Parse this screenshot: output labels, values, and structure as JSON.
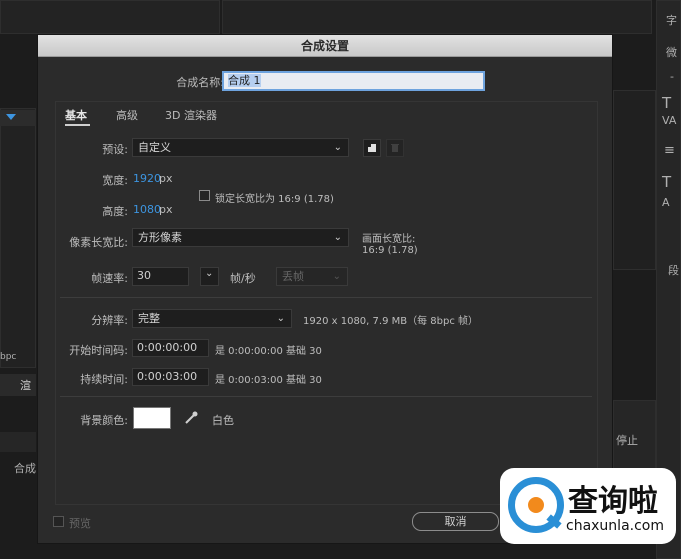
{
  "dialog": {
    "title": "合成设置",
    "name_label": "合成名称:",
    "name_value": "合成 1",
    "tabs": [
      {
        "label": "基本"
      },
      {
        "label": "高级"
      },
      {
        "label": "3D 渲染器"
      }
    ],
    "preset": {
      "label": "预设:",
      "value": "自定义"
    },
    "width": {
      "label": "宽度:",
      "value": "1920",
      "unit": "px"
    },
    "height": {
      "label": "高度:",
      "value": "1080",
      "unit": "px"
    },
    "lock_aspect": {
      "label": "锁定长宽比为 16:9 (1.78)",
      "checked": false
    },
    "pixel_aspect": {
      "label": "像素长宽比:",
      "value": "方形像素"
    },
    "frame_aspect": {
      "label": "画面长宽比:",
      "value": "16:9 (1.78)"
    },
    "frame_rate": {
      "label": "帧速率:",
      "value": "30",
      "unit": "帧/秒",
      "drop_frame": "丢帧"
    },
    "resolution": {
      "label": "分辨率:",
      "value": "完整",
      "info": "1920 x 1080, 7.9 MB（每 8bpc 帧）"
    },
    "start_timecode": {
      "label": "开始时间码:",
      "value": "0:00:00:00",
      "info": "是 0:00:00:00 基础 30"
    },
    "duration": {
      "label": "持续时间:",
      "value": "0:00:03:00",
      "info": "是 0:00:03:00 基础 30"
    },
    "bg_color": {
      "label": "背景颜色:",
      "name": "白色",
      "color": "#ffffff"
    },
    "preview_label": "预览",
    "cancel_label": "取消"
  },
  "background": {
    "right_labels": [
      "字",
      "微",
      "-",
      "段"
    ],
    "left_labels": [
      "合成",
      "渲",
      "bpc"
    ],
    "stop_label": "停止"
  },
  "watermark": {
    "cn": "查询啦",
    "en": "chaxunla.com"
  },
  "icons": {
    "new_preset": "new-preset-icon",
    "delete_preset": "trash-icon",
    "eyedropper": "eyedropper-icon",
    "dropdown": "chevron-down-icon"
  }
}
